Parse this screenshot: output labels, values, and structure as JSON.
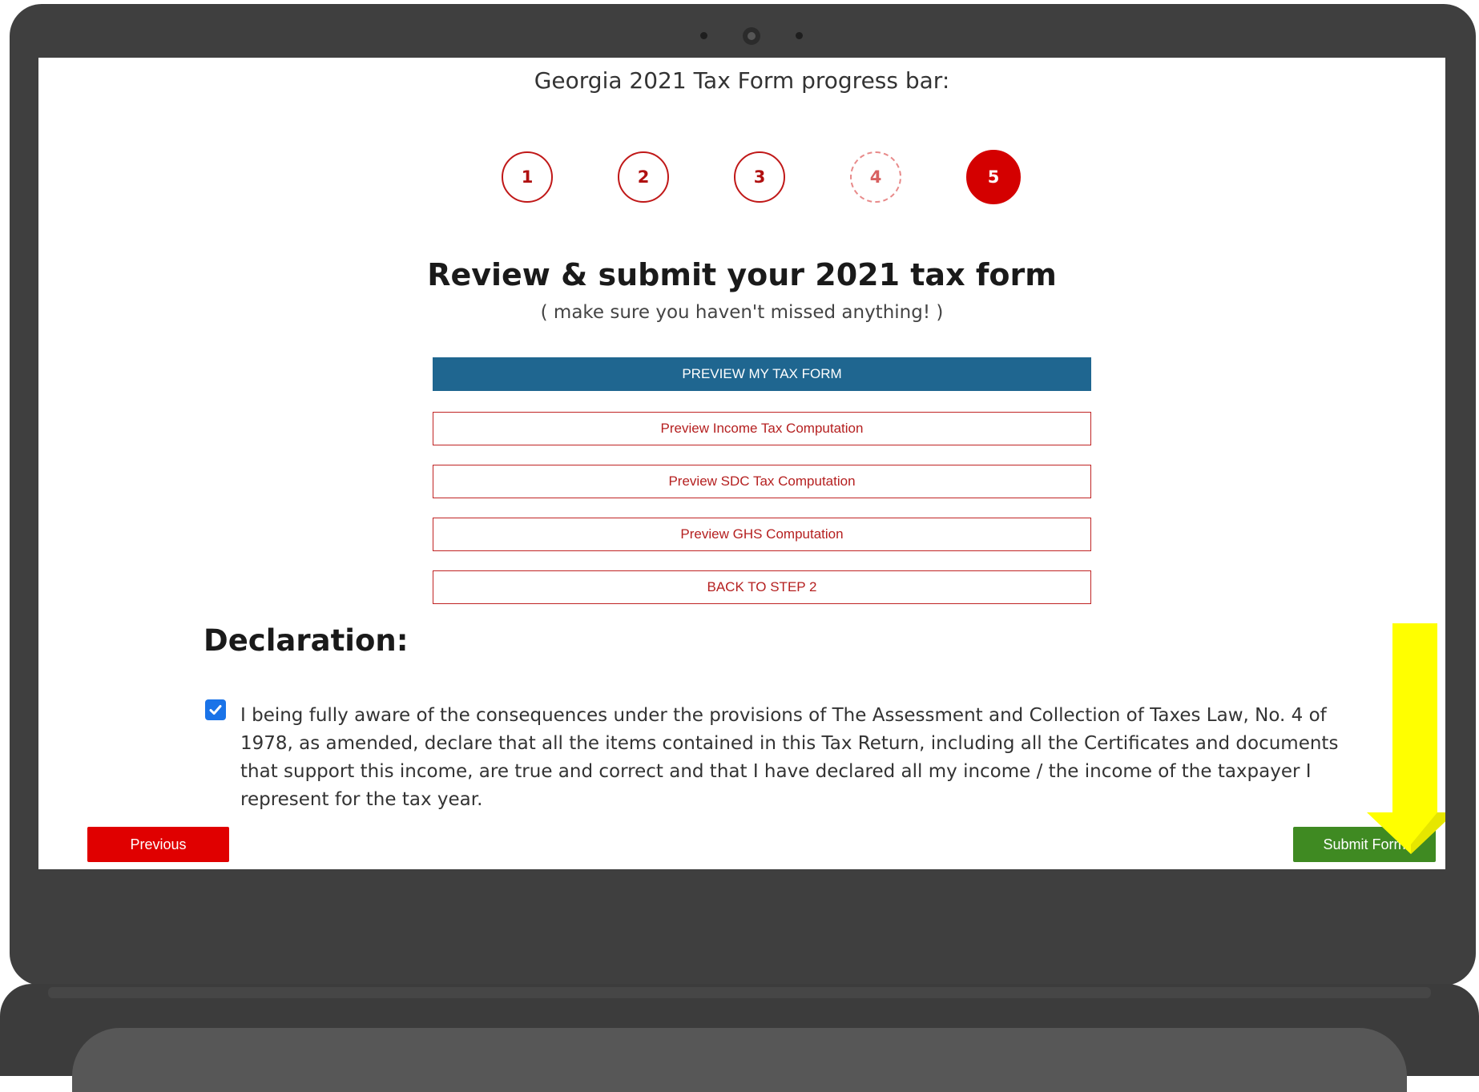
{
  "progress": {
    "title": "Georgia 2021 Tax Form progress bar:",
    "steps": [
      "1",
      "2",
      "3",
      "4",
      "5"
    ],
    "current_step": 5
  },
  "review": {
    "heading": "Review & submit your 2021 tax form",
    "subheading": "( make sure you haven't missed anything! )"
  },
  "buttons": {
    "preview_form": "PREVIEW MY TAX FORM",
    "preview_income": "Preview Income Tax Computation",
    "preview_sdc": "Preview SDC Tax Computation",
    "preview_ghs": "Preview GHS Computation",
    "back_step2": "BACK TO STEP 2"
  },
  "declaration": {
    "title": "Declaration:",
    "checked": true,
    "text": "I being fully aware of the consequences under the provisions of The Assessment and Collection of Taxes Law, No. 4 of 1978, as amended, declare that all the items contained in this Tax Return, including all the Certificates and documents that support this income, are true and correct and that I have declared all my income / the income of the taxpayer I represent for the tax year."
  },
  "nav": {
    "previous": "Previous",
    "submit": "Submit Form"
  },
  "colors": {
    "step_active": "#d40000",
    "primary_button": "#1f6690",
    "outline_button": "#c02424",
    "previous_button": "#e00000",
    "submit_button": "#3f8a22",
    "annotation_arrow": "#ffff00",
    "laptop_frame": "#3f3f3f"
  },
  "icons": {
    "checkbox": "checkmark-icon",
    "annotation": "arrow-down-icon"
  }
}
